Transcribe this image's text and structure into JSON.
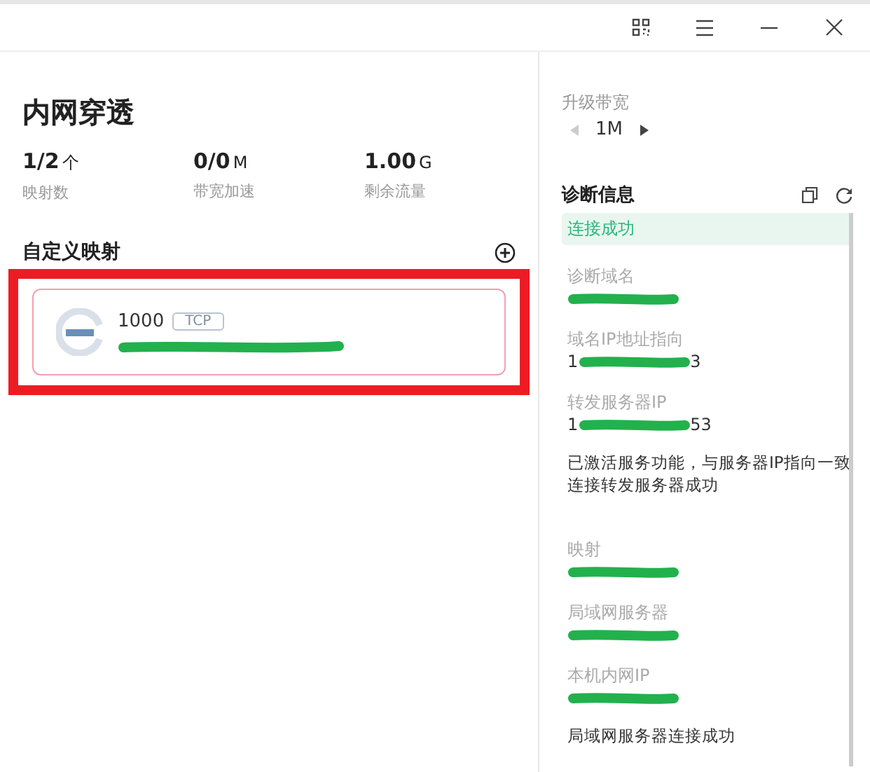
{
  "toolbar": {
    "buttons": [
      {
        "kind": "qr"
      },
      {
        "kind": "menu"
      },
      {
        "kind": "minimize"
      },
      {
        "kind": "close"
      }
    ]
  },
  "main": {
    "title": "内网穿透",
    "stats": [
      {
        "value": "1/2",
        "unit": "个",
        "label": "映射数"
      },
      {
        "value": "0/0",
        "unit": "M",
        "label": "带宽加速"
      },
      {
        "value": "1.00",
        "unit": "G",
        "label": "剩余流量"
      }
    ],
    "section_title": "自定义映射",
    "mappings": [
      {
        "port": "1000",
        "protocol": "TCP",
        "highlighted": true
      }
    ]
  },
  "side": {
    "upgrade": {
      "label": "升级带宽",
      "value": "1M",
      "prev_disabled": true,
      "next_disabled": false
    },
    "diagnosis": {
      "title": "诊断信息",
      "status": "连接成功",
      "items": [
        {
          "kind": "field",
          "label": "诊断域名"
        },
        {
          "kind": "field",
          "label": "域名IP地址指向",
          "prefix": "1",
          "suffix": "3"
        },
        {
          "kind": "field",
          "label": "转发服务器IP",
          "prefix": "1",
          "suffix": "53"
        },
        {
          "kind": "message",
          "text": "已激活服务功能，与服务器IP指向一致连接转发服务器成功"
        },
        {
          "kind": "gap"
        },
        {
          "kind": "field",
          "label": "映射"
        },
        {
          "kind": "field",
          "label": "局域网服务器"
        },
        {
          "kind": "field",
          "label": "本机内网IP"
        },
        {
          "kind": "message",
          "text": "局域网服务器连接成功"
        }
      ]
    }
  }
}
